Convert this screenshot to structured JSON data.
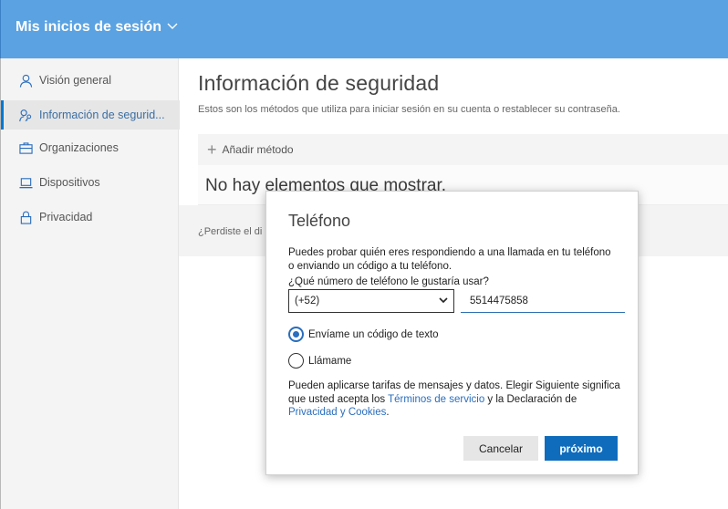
{
  "header": {
    "title": "Mis inicios de sesión"
  },
  "sidebar": {
    "items": [
      {
        "label": "Visión general",
        "icon": "person-icon",
        "active": false
      },
      {
        "label": "Información de segurid...",
        "icon": "security-info-icon",
        "active": true
      },
      {
        "label": "Organizaciones",
        "icon": "briefcase-icon",
        "active": false
      },
      {
        "label": "Dispositivos",
        "icon": "laptop-icon",
        "active": false
      },
      {
        "label": "Privacidad",
        "icon": "lock-icon",
        "active": false
      }
    ]
  },
  "main": {
    "title": "Información de seguridad",
    "subtitle": "Estos son los métodos que utiliza para iniciar sesión en su cuenta o restablecer su contraseña.",
    "add_method": "Añadir método",
    "empty_message": "No hay elementos que mostrar.",
    "lost_device_link": "¿Perdiste el di"
  },
  "dialog": {
    "title": "Teléfono",
    "description": "Puedes probar quién eres respondiendo a una llamada en tu teléfono o enviando un código a tu teléfono.",
    "question": "¿Qué número de teléfono le gustaría usar?",
    "country_code": "(+52)",
    "phone_value": "5514475858",
    "options": [
      {
        "label": "Envíame un código de texto",
        "checked": true
      },
      {
        "label": "Llámame",
        "checked": false
      }
    ],
    "terms": {
      "prefix": "Pueden aplicarse tarifas de mensajes y datos. Elegir Siguiente significa que usted acepta los ",
      "tos_link": "Términos de servicio",
      "middle": " y la Declaración de ",
      "privacy_link": "Privacidad y Cookies",
      "suffix": "."
    },
    "cancel_label": "Cancelar",
    "next_label": "próximo"
  },
  "colors": {
    "header_bg": "#5aa2e1",
    "accent": "#0f6cbd",
    "link": "#2a6ebd"
  }
}
